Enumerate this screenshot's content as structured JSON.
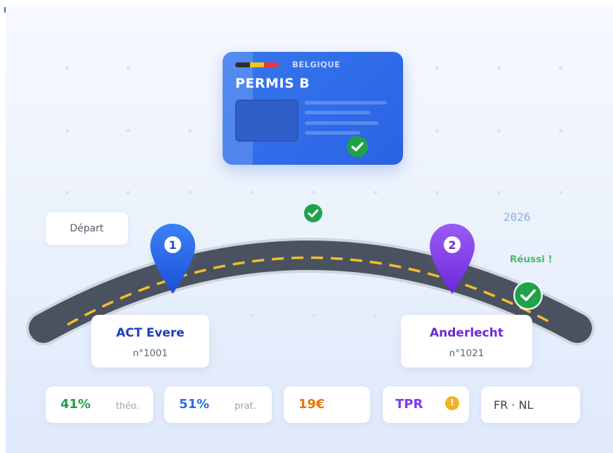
{
  "license_card": {
    "country": "BELGIQUE",
    "title": "PERMIS B",
    "flag_colors": [
      "#2d2d2d",
      "#f2c31b",
      "#e0393e"
    ]
  },
  "route": {
    "start_label": "Départ",
    "year": "2026",
    "result_text": "Réussi !",
    "stations": [
      {
        "number": "1",
        "name": "ACT Evere",
        "code": "n°1001",
        "color": "#2962e6"
      },
      {
        "number": "2",
        "name": "Anderlecht",
        "code": "n°1021",
        "color": "#7c3aed"
      }
    ]
  },
  "stats": {
    "theory": {
      "value": "41%",
      "label": "théo.",
      "color": "#1f9d4a"
    },
    "practice": {
      "value": "51%",
      "label": "prat.",
      "color": "#2d6be6"
    },
    "price": {
      "value": "19€",
      "color": "#e07a0c"
    },
    "tpr": {
      "value": "TPR",
      "color": "#7c3aed",
      "icon": "info-icon"
    },
    "languages": {
      "value": "FR · NL",
      "color": "#3b4250"
    }
  },
  "colors": {
    "road": "#4a5260",
    "road_dashes": "#f2bd2e",
    "success_green": "#1fa34a"
  }
}
